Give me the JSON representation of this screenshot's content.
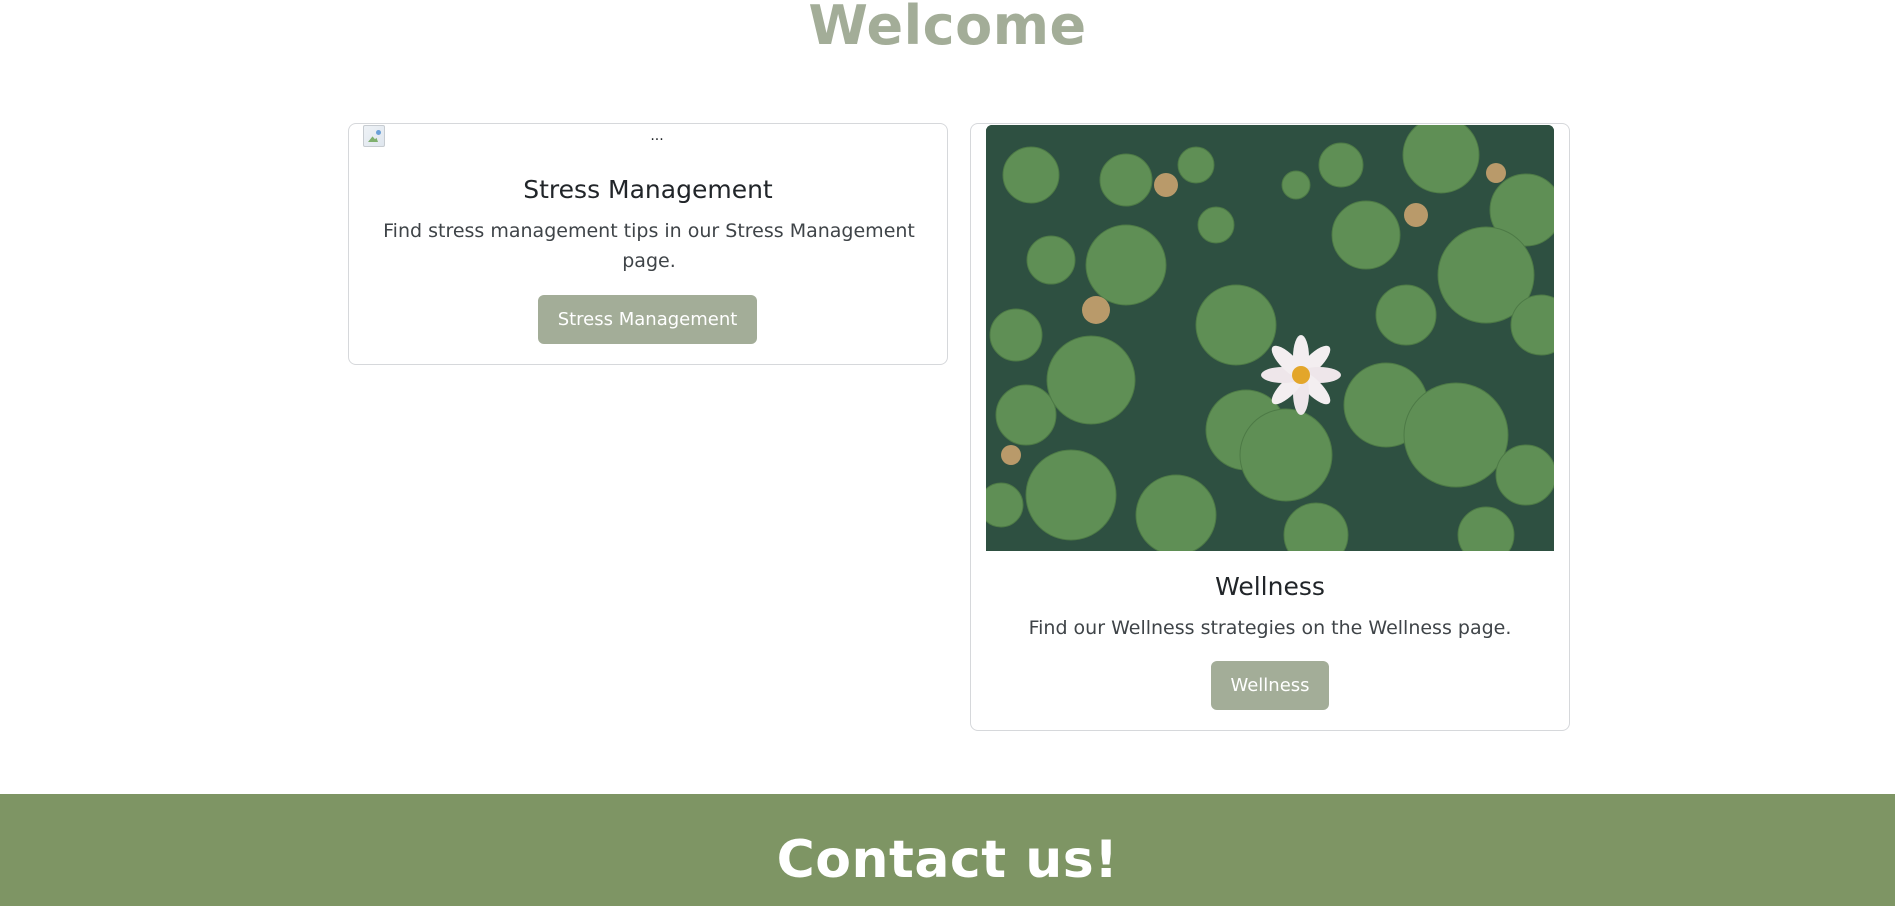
{
  "header": {
    "title": "Welcome"
  },
  "cards": [
    {
      "image_alt": "...",
      "title": "Stress Management",
      "text": "Find stress management tips in our Stress Management page.",
      "button_label": "Stress Management"
    },
    {
      "image_description": "water lily",
      "title": "Wellness",
      "text": "Find our Wellness strategies on the Wellness page.",
      "button_label": "Wellness"
    }
  ],
  "footer": {
    "title": "Contact us!"
  },
  "colors": {
    "accent": "#a3ad98",
    "footer_bg": "#7e9564",
    "card_border": "#d6d8db"
  }
}
